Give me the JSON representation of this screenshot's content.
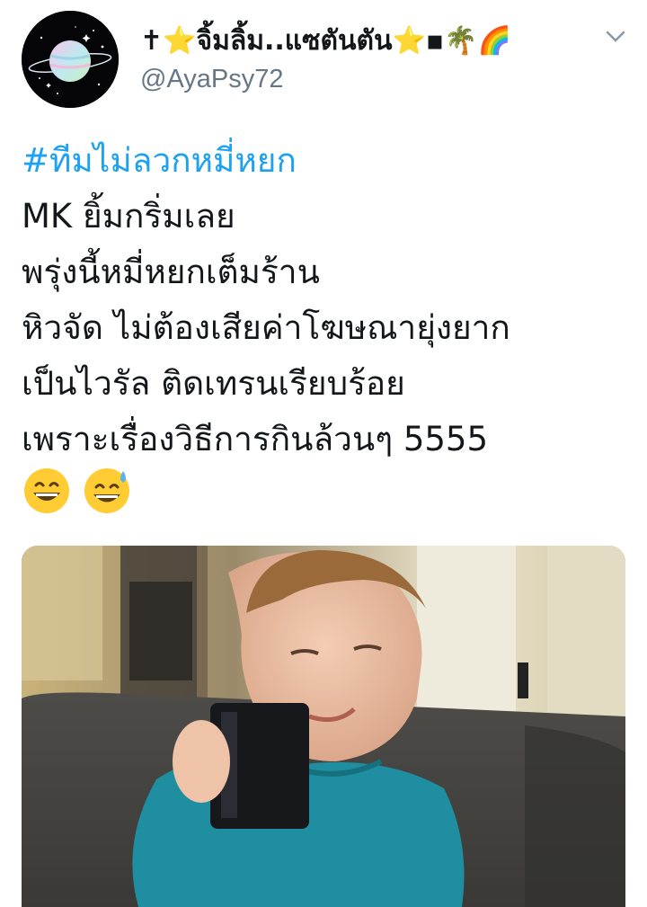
{
  "tweet": {
    "author": {
      "display_name": "✝⭐จิ้มลิ้ม..แซตันตัน⭐▪🌴🌈",
      "handle": "@AyaPsy72",
      "avatar_icon": "planet-avatar-icon"
    },
    "menu_icon": "chevron-down-icon",
    "text_lines": [
      "#ทีมไม่ลวกหมี่หยก",
      "MK  ยิ้มกริ่มเลย",
      "พรุ่งนี้หมี่หยกเต็มร้าน",
      "หิวจัด ไม่ต้องเสียค่าโฆษณายุ่งยาก",
      "เป็นไวรัล ติดเทรนเรียบร้อย",
      "เพราะเรื่องวิธีการกินล้วนๆ 5555"
    ],
    "emojis": [
      "grinning-face-icon",
      "sweat-smile-face-icon"
    ],
    "media": {
      "description_icon": "boy-drinking-mug-photo"
    }
  },
  "colors": {
    "hashtag": "#1da1f2",
    "text": "#14171a",
    "secondary": "#657786",
    "background": "#ffffff"
  }
}
